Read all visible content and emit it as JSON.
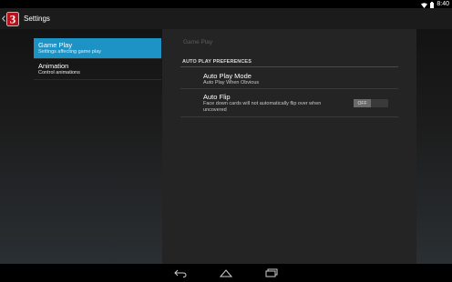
{
  "status_bar": {
    "time": "8:40",
    "icons": [
      "wifi-icon",
      "battery-icon"
    ]
  },
  "action_bar": {
    "title": "Settings",
    "logo_text": "3"
  },
  "nav": {
    "items": [
      {
        "title": "Game Play",
        "subtitle": "Settings affecting game play",
        "selected": true
      },
      {
        "title": "Animation",
        "subtitle": "Control animations",
        "selected": false
      }
    ]
  },
  "panel": {
    "header": "Game Play",
    "section_title": "AUTO PLAY PREFERENCES",
    "prefs": [
      {
        "title": "Auto Play Mode",
        "subtitle": "Auto Play When Obvious"
      },
      {
        "title": "Auto Flip",
        "subtitle": "Face down cards will not automatically flip over when uncovered",
        "toggle": "OFF"
      }
    ]
  },
  "colors": {
    "accent": "#1c93c4",
    "panel_bg": "#242424",
    "action_bar_bg": "#1b1b1b"
  }
}
